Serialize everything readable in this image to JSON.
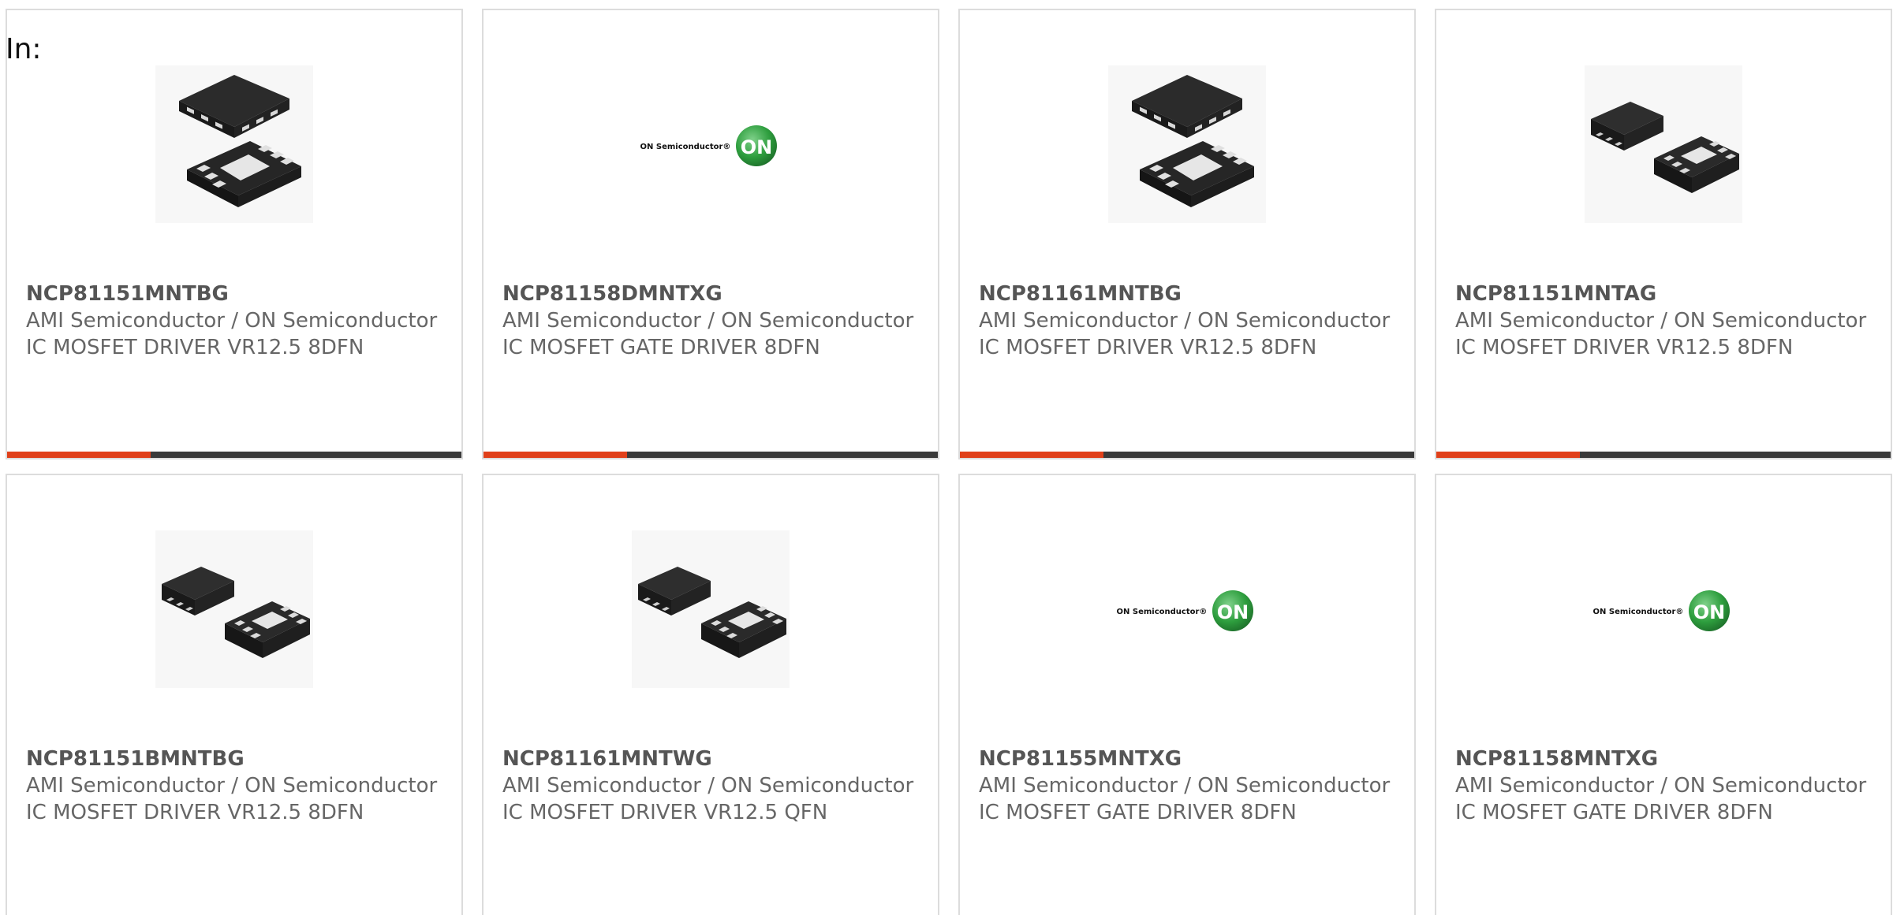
{
  "filter": {
    "label": "In:"
  },
  "colors": {
    "accent": "#e0401a",
    "bar": "#3a3a3a",
    "border": "#dcdcdc",
    "text": "#666666",
    "logo_green": "#2e9e3e"
  },
  "products": [
    {
      "part_number": "NCP81151MNTBG",
      "manufacturer": "AMI Semiconductor / ON Semiconductor",
      "description": "IC MOSFET DRIVER VR12.5 8DFN",
      "image": "dfn-chip-angled-image"
    },
    {
      "part_number": "NCP81158DMNTXG",
      "manufacturer": "AMI Semiconductor / ON Semiconductor",
      "description": "IC MOSFET GATE DRIVER 8DFN",
      "image": "on-semiconductor-logo-image",
      "logo_text": "ON Semiconductor®",
      "logo_badge": "ON"
    },
    {
      "part_number": "NCP81161MNTBG",
      "manufacturer": "AMI Semiconductor / ON Semiconductor",
      "description": "IC MOSFET DRIVER VR12.5 8DFN",
      "image": "dfn-chip-angled-image"
    },
    {
      "part_number": "NCP81151MNTAG",
      "manufacturer": "AMI Semiconductor / ON Semiconductor",
      "description": "IC MOSFET DRIVER VR12.5 8DFN",
      "image": "dfn-chip-pair-image"
    },
    {
      "part_number": "NCP81151BMNTBG",
      "manufacturer": "AMI Semiconductor / ON Semiconductor",
      "description": "IC MOSFET DRIVER VR12.5 8DFN",
      "image": "dfn-chip-pair-image"
    },
    {
      "part_number": "NCP81161MNTWG",
      "manufacturer": "AMI Semiconductor / ON Semiconductor",
      "description": "IC MOSFET DRIVER VR12.5 QFN",
      "image": "dfn-chip-pair-image"
    },
    {
      "part_number": "NCP81155MNTXG",
      "manufacturer": "AMI Semiconductor / ON Semiconductor",
      "description": "IC MOSFET GATE DRIVER 8DFN",
      "image": "on-semiconductor-logo-image",
      "logo_text": "ON Semiconductor®",
      "logo_badge": "ON"
    },
    {
      "part_number": "NCP81158MNTXG",
      "manufacturer": "AMI Semiconductor / ON Semiconductor",
      "description": "IC MOSFET GATE DRIVER 8DFN",
      "image": "on-semiconductor-logo-image",
      "logo_text": "ON Semiconductor®",
      "logo_badge": "ON"
    }
  ]
}
